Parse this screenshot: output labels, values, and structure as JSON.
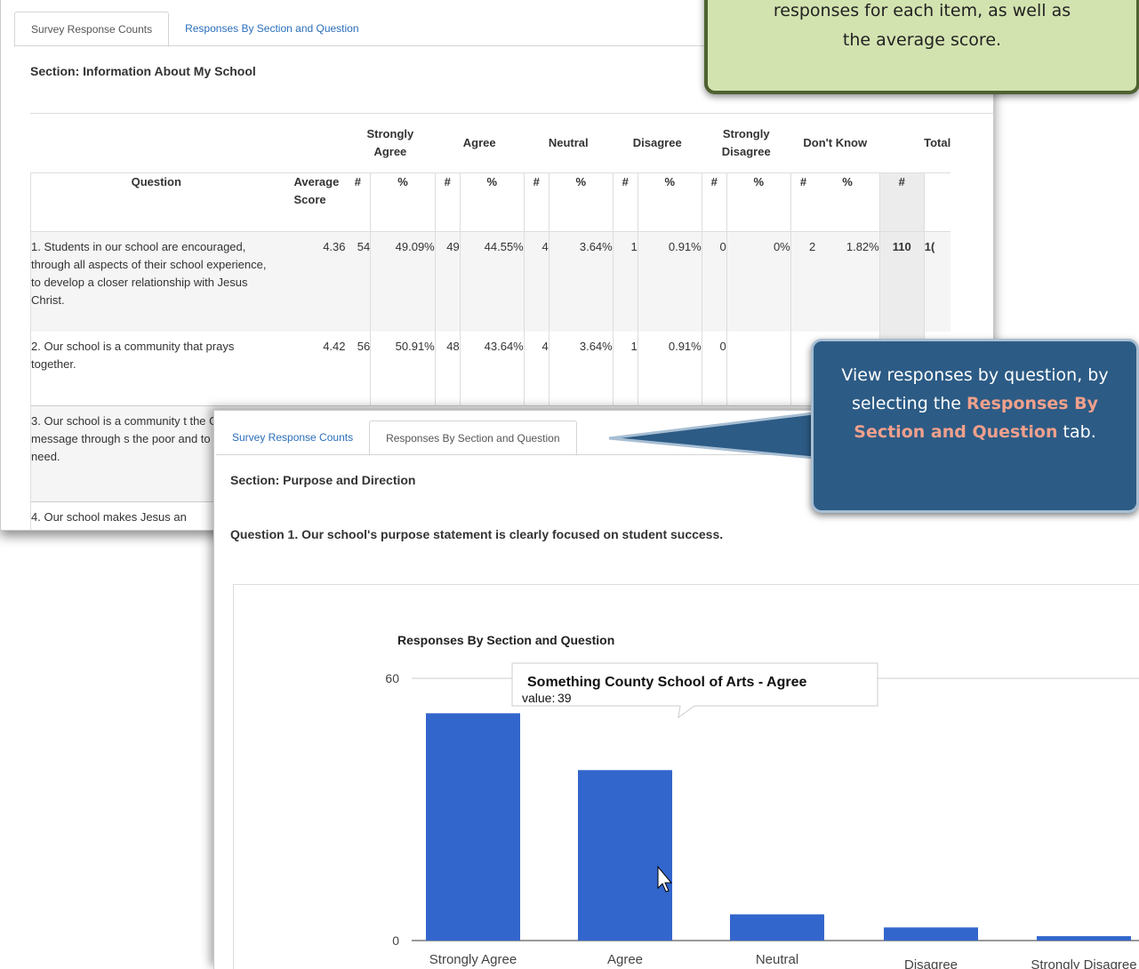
{
  "back_window": {
    "tabs": [
      {
        "label": "Survey Response Counts",
        "active": true
      },
      {
        "label": "Responses By Section and Question",
        "active": false
      }
    ],
    "section_title": "Section: Information About My School",
    "group_headers": [
      "Strongly Agree",
      "Agree",
      "Neutral",
      "Disagree",
      "Strongly Disagree",
      "Don't Know",
      "Total"
    ],
    "column_headers": {
      "question": "Question",
      "average": "Average Score",
      "count": "#",
      "pct": "%"
    },
    "rows": [
      {
        "question": "1. Students in our school are encouraged, through all aspects of their school experience, to develop a closer relationship with Jesus Christ.",
        "avg": "4.36",
        "sa_n": "54",
        "sa_p": "49.09%",
        "a_n": "49",
        "a_p": "44.55%",
        "n_n": "4",
        "n_p": "3.64%",
        "d_n": "1",
        "d_p": "0.91%",
        "sd_n": "0",
        "sd_p": "0%",
        "dk_n": "2",
        "dk_p": "1.82%",
        "total": "110",
        "total2": "1("
      },
      {
        "question": "2. Our school is a community that prays together.",
        "avg": "4.42",
        "sa_n": "56",
        "sa_p": "50.91%",
        "a_n": "48",
        "a_p": "43.64%",
        "n_n": "4",
        "n_p": "3.64%",
        "d_n": "1",
        "d_p": "0.91%",
        "sd_n": "0",
        "sd_p": "",
        "dk_n": "",
        "dk_p": "",
        "total": "",
        "total2": ""
      },
      {
        "question": "3. Our school is a community t the Gospel message through s the poor and to those in need.",
        "avg": "",
        "sa_n": "",
        "sa_p": "",
        "a_n": "",
        "a_p": "",
        "n_n": "",
        "n_p": "",
        "d_n": "",
        "d_p": "",
        "sd_n": "",
        "sd_p": "",
        "dk_n": "",
        "dk_p": "",
        "total": "",
        "total2": ""
      },
      {
        "question": "4. Our school makes Jesus an",
        "avg": "",
        "sa_n": "",
        "sa_p": "",
        "a_n": "",
        "a_p": "",
        "n_n": "",
        "n_p": "",
        "d_n": "",
        "d_p": "",
        "sd_n": "",
        "sd_p": "",
        "dk_n": "",
        "dk_p": "",
        "total": "",
        "total2": ""
      }
    ]
  },
  "front_window": {
    "tabs": [
      {
        "label": "Survey Response Counts",
        "active": false
      },
      {
        "label": "Responses By Section and Question",
        "active": true
      }
    ],
    "section_title": "Section: Purpose and Direction",
    "question_title": "Question 1. Our school's purpose statement is clearly focused on student success."
  },
  "chart_data": {
    "type": "bar",
    "title": "Responses By Section and Question",
    "categories": [
      "Strongly Agree",
      "Agree",
      "Neutral",
      "Disagree",
      "Strongly Disagree"
    ],
    "values": [
      52,
      39,
      6,
      3,
      1
    ],
    "ylim": [
      0,
      60
    ],
    "yticks": [
      "0",
      "60"
    ],
    "bar_color": "#3366cc",
    "tooltip": {
      "title": "Something County School of Arts - Agree",
      "label": "value:",
      "value": "39"
    }
  },
  "callouts": {
    "green": {
      "line1": "responses for each item, as well as",
      "line2": "the average score."
    },
    "blue": {
      "pre": "View responses by question, by selecting the ",
      "highlight": "Responses By Section and Question",
      "post": " tab."
    }
  }
}
